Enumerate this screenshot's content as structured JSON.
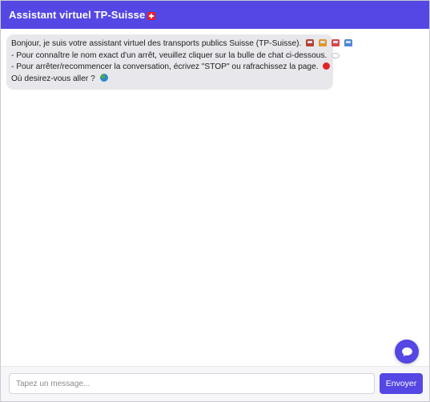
{
  "header": {
    "title": "Assistant virtuel TP-Suisse",
    "flag_icon": "swiss-flag-icon"
  },
  "bot_message": {
    "line1": "Bonjour, je suis votre assistant virtuel des transports publics Suisse (TP-Suisse).",
    "line2": "- Pour connaître le nom exact d'un arrêt, veuillez cliquer sur la bulle de chat ci-dessous.",
    "line3": "- Pour arrêter/recommencer la conversation, écrivez \"STOP\" ou rafrachissez la page.",
    "line4": "Où desirez-vous aller ?",
    "emojis": [
      "train-icon",
      "tram-icon",
      "railway-car-icon",
      "bullet-train-icon",
      "speech-bubble-icon",
      "red-circle-icon",
      "globe-icon"
    ]
  },
  "chat_fab": {
    "icon": "chat-bubble-icon"
  },
  "composer": {
    "placeholder": "Tapez un message...",
    "send_label": "Envoyer"
  },
  "colors": {
    "accent": "#5447e4",
    "bubble_bg": "#e8e8ec",
    "composer_bg": "#f6f6f8"
  }
}
